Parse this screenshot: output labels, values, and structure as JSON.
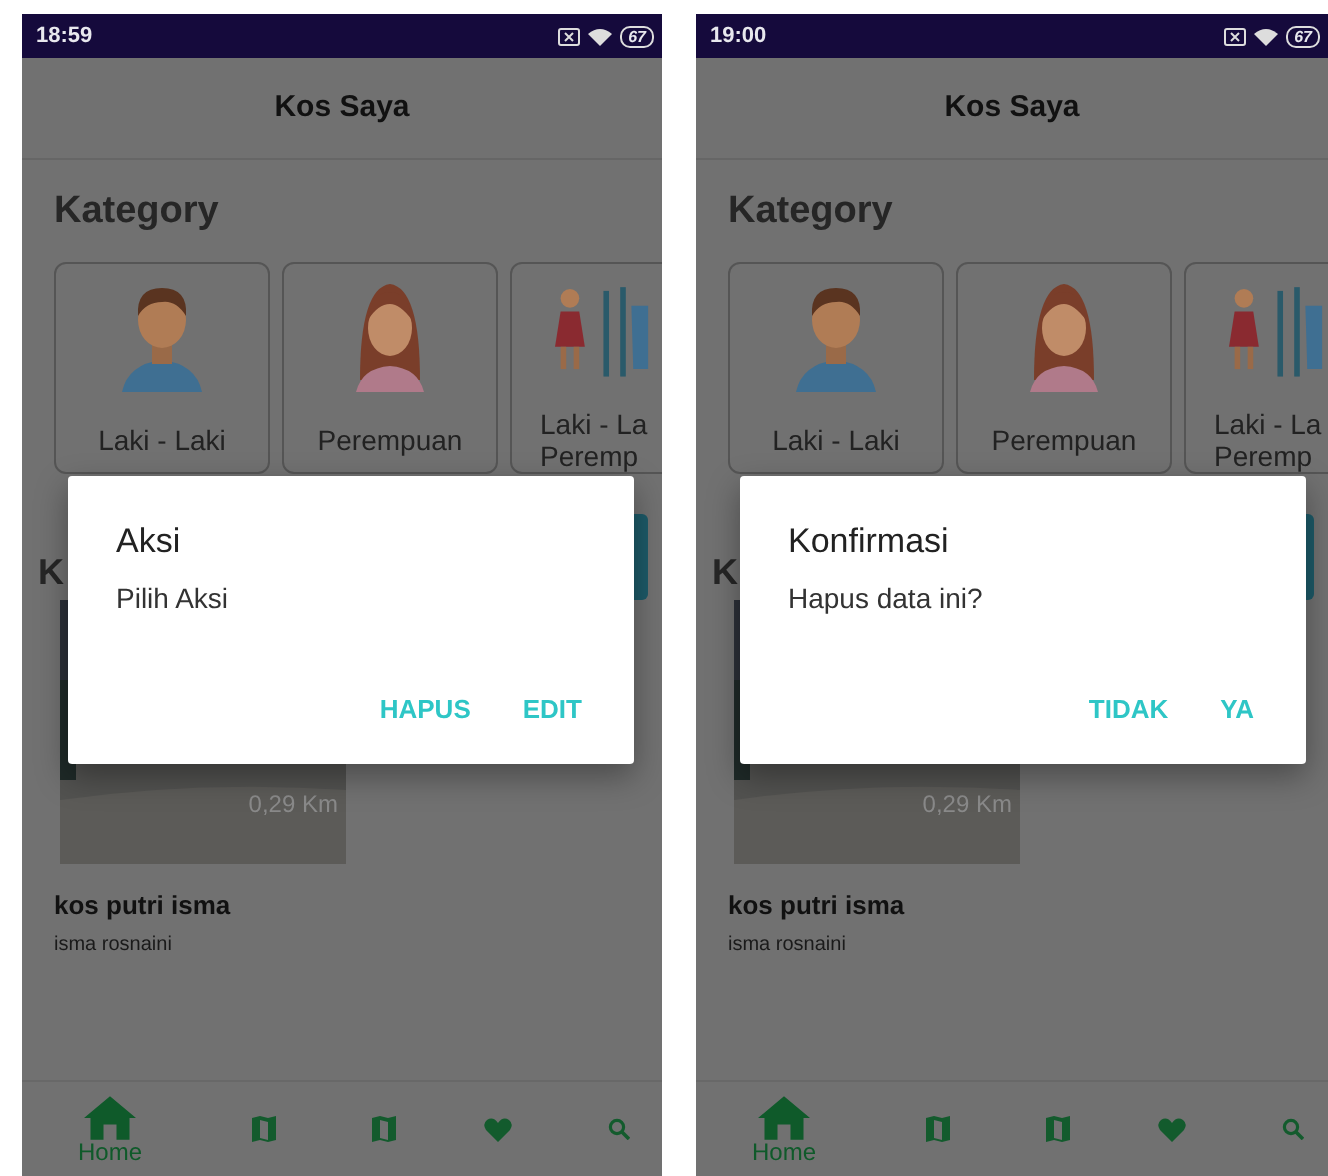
{
  "screens": [
    {
      "status_bar": {
        "time": "18:59",
        "battery": "67"
      },
      "header": {
        "title": "Kos Saya"
      },
      "category_heading": "Kategory",
      "categories": [
        {
          "kind": "male",
          "label_lines": [
            "Laki - Laki"
          ]
        },
        {
          "kind": "female",
          "label_lines": [
            "Perempuan"
          ]
        },
        {
          "kind": "mixed",
          "label_lines": [
            "Laki - La",
            "Peremp"
          ]
        }
      ],
      "section_heading": "K",
      "listing": {
        "distance": "0,29 Km",
        "title": "kos putri isma",
        "owner": "isma rosnaini"
      },
      "dialog": {
        "title": "Aksi",
        "message": "Pilih Aksi",
        "buttons": [
          "HAPUS",
          "EDIT"
        ]
      },
      "bottom_nav": [
        {
          "kind": "home",
          "label": "Home",
          "selected": true
        },
        {
          "kind": "map",
          "selected": false
        },
        {
          "kind": "map",
          "selected": false
        },
        {
          "kind": "heart",
          "selected": false
        },
        {
          "kind": "search",
          "selected": false
        }
      ]
    },
    {
      "status_bar": {
        "time": "19:00",
        "battery": "67"
      },
      "header": {
        "title": "Kos Saya"
      },
      "category_heading": "Kategory",
      "categories": [
        {
          "kind": "male",
          "label_lines": [
            "Laki - Laki"
          ]
        },
        {
          "kind": "female",
          "label_lines": [
            "Perempuan"
          ]
        },
        {
          "kind": "mixed",
          "label_lines": [
            "Laki - La",
            "Peremp"
          ]
        }
      ],
      "section_heading": "K",
      "listing": {
        "distance": "0,29 Km",
        "title": "kos putri isma",
        "owner": "isma rosnaini"
      },
      "dialog": {
        "title": "Konfirmasi",
        "message": "Hapus data ini?",
        "buttons": [
          "TIDAK",
          "YA"
        ]
      },
      "bottom_nav": [
        {
          "kind": "home",
          "label": "Home",
          "selected": true
        },
        {
          "kind": "map",
          "selected": false
        },
        {
          "kind": "map",
          "selected": false
        },
        {
          "kind": "heart",
          "selected": false
        },
        {
          "kind": "search",
          "selected": false
        }
      ]
    }
  ]
}
